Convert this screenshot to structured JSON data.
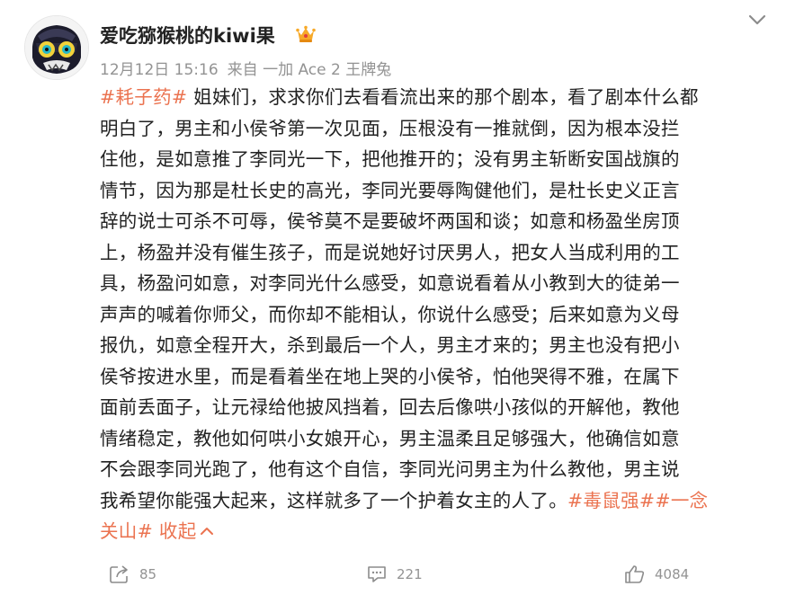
{
  "post": {
    "author": {
      "name": "爱吃猕猴桃的kiwi果"
    },
    "meta": {
      "date": "12月12日 15:16",
      "source": "来自 一加 Ace 2 王牌兔"
    },
    "content": {
      "lines": [
        [
          {
            "type": "tag",
            "text": "#耗子药#"
          },
          {
            "type": "text",
            "text": " 姐妹们，求求你们去看看流出来的那个剧本，看了剧本什么都"
          }
        ],
        [
          {
            "type": "text",
            "text": "明白了，男主和小侯爷第一次见面，压根没有一推就倒，因为根本没拦"
          }
        ],
        [
          {
            "type": "text",
            "text": "住他，是如意推了李同光一下，把他推开的；没有男主斩断安国战旗的"
          }
        ],
        [
          {
            "type": "text",
            "text": "情节，因为那是杜长史的高光，李同光要辱陶健他们，是杜长史义正言"
          }
        ],
        [
          {
            "type": "text",
            "text": "辞的说士可杀不可辱，侯爷莫不是要破坏两国和谈；如意和杨盈坐房顶"
          }
        ],
        [
          {
            "type": "text",
            "text": "上，杨盈并没有催生孩子，而是说她好讨厌男人，把女人当成利用的工"
          }
        ],
        [
          {
            "type": "text",
            "text": "具，杨盈问如意，对李同光什么感受，如意说看着从小教到大的徒弟一"
          }
        ],
        [
          {
            "type": "text",
            "text": "声声的喊着你师父，而你却不能相认，你说什么感受；后来如意为义母"
          }
        ],
        [
          {
            "type": "text",
            "text": "报仇，如意全程开大，杀到最后一个人，男主才来的；男主也没有把小"
          }
        ],
        [
          {
            "type": "text",
            "text": "侯爷按进水里，而是看着坐在地上哭的小侯爷，怕他哭得不雅，在属下"
          }
        ],
        [
          {
            "type": "text",
            "text": "面前丢面子，让元禄给他披风挡着，回去后像哄小孩似的开解他，教他"
          }
        ],
        [
          {
            "type": "text",
            "text": "情绪稳定，教他如何哄小女娘开心，男主温柔且足够强大，他确信如意"
          }
        ],
        [
          {
            "type": "text",
            "text": "不会跟李同光跑了，他有这个自信，李同光问男主为什么教他，男主说"
          }
        ],
        [
          {
            "type": "text",
            "text": "我希望你能强大起来，这样就多了一个护着女主的人了。"
          },
          {
            "type": "tag",
            "text": "#毒鼠强#"
          },
          {
            "type": "tag",
            "text": "#一念"
          }
        ],
        [
          {
            "type": "tag",
            "text": "关山#"
          },
          {
            "type": "text",
            "text": " "
          },
          {
            "type": "collapse",
            "text": "收起"
          }
        ]
      ]
    },
    "actions": {
      "repost_count": "85",
      "comment_count": "221",
      "like_count": "4084"
    }
  },
  "colors": {
    "accent": "#eb7350",
    "meta": "#939393",
    "text": "#222222"
  },
  "icons": [
    "avatar-mask",
    "vip-crown-icon",
    "chevron-down-icon",
    "repost-icon",
    "comment-icon",
    "like-icon",
    "chevron-up-icon"
  ]
}
